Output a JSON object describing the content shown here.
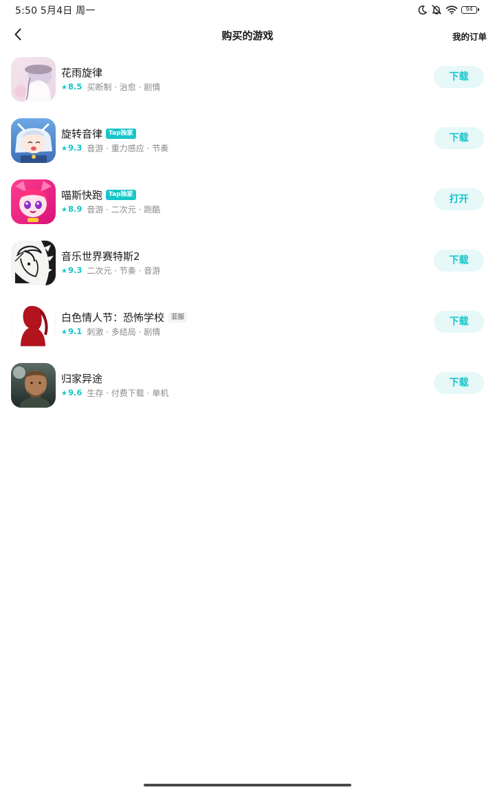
{
  "status_bar": {
    "time": "5:50  5月4日 周一",
    "battery": "94"
  },
  "header": {
    "title": "购买的游戏",
    "orders_label": "我的订单"
  },
  "games": [
    {
      "name": "花雨旋律",
      "badge": "",
      "rating": "8.5",
      "tags": "买断制 · 治愈 · 剧情",
      "action": "下载",
      "icon": "hua-yu-xuan-lv-icon"
    },
    {
      "name": "旋转音律",
      "badge": "Tap独家",
      "rating": "9.3",
      "tags": "音游 · 重力感应 · 节奏",
      "action": "下载",
      "icon": "xuan-zhuan-yin-lv-icon"
    },
    {
      "name": "喵斯快跑",
      "badge": "Tap独家",
      "rating": "8.9",
      "tags": "音游 · 二次元 · 跑酷",
      "action": "打开",
      "icon": "miao-si-kuai-pao-icon"
    },
    {
      "name": "音乐世界赛特斯2",
      "badge": "",
      "rating": "9.3",
      "tags": "二次元 · 节奏 · 音游",
      "action": "下载",
      "icon": "cytus-2-icon"
    },
    {
      "name": "白色情人节：恐怖学校",
      "badge": "",
      "region": "亚服",
      "rating": "9.1",
      "tags": "刺激 · 多结局 · 剧情",
      "action": "下载",
      "icon": "white-day-icon"
    },
    {
      "name": "归家异途",
      "badge": "",
      "rating": "9.6",
      "tags": "生存 · 付费下载 · 单机",
      "action": "下载",
      "icon": "gui-jia-yi-tu-icon"
    }
  ],
  "colors": {
    "accent": "#15c5c9",
    "button_bg": "#e6f8f8",
    "tag_text": "#8a8a8a"
  }
}
